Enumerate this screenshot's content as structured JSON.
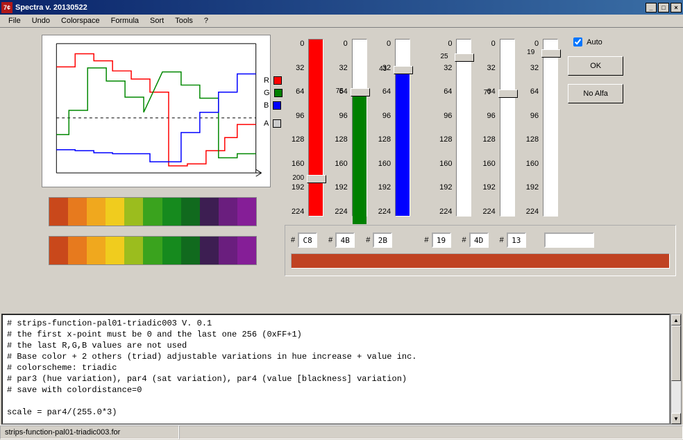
{
  "window": {
    "title": "Spectra v. 20130522"
  },
  "menu": {
    "file": "File",
    "undo": "Undo",
    "colorspace": "Colorspace",
    "formula": "Formula",
    "sort": "Sort",
    "tools": "Tools",
    "help": "?"
  },
  "legend": {
    "r": "R",
    "g": "G",
    "b": "B",
    "a": "A"
  },
  "ticks": [
    "0",
    "32",
    "64",
    "96",
    "128",
    "160",
    "192",
    "224"
  ],
  "sliders": {
    "r": {
      "value": 200,
      "hex": "C8"
    },
    "g": {
      "value": 75,
      "hex": "4B"
    },
    "b": {
      "value": 43,
      "hex": "2B"
    },
    "s4": {
      "value": 25,
      "hex": "19"
    },
    "s5": {
      "value": 77,
      "hex": "4D"
    },
    "s6": {
      "value": 19,
      "hex": "13"
    }
  },
  "buttons": {
    "auto_label": "Auto",
    "auto_checked": true,
    "ok": "OK",
    "noalfa": "No Alfa"
  },
  "hex_prefix": "#",
  "palette": [
    "#c9481b",
    "#e77a1e",
    "#f0a81e",
    "#f0cc1e",
    "#9bbd1e",
    "#3aa31e",
    "#168a1e",
    "#116a1e",
    "#3d1e52",
    "#6a1e7e",
    "#851e97"
  ],
  "chart_data": {
    "type": "line",
    "xlim": [
      0,
      256
    ],
    "ylim": [
      0,
      256
    ],
    "series": [
      {
        "name": "R",
        "color": "#ff0000",
        "points": [
          [
            0,
            210
          ],
          [
            24,
            210
          ],
          [
            24,
            236
          ],
          [
            48,
            236
          ],
          [
            48,
            222
          ],
          [
            72,
            222
          ],
          [
            72,
            202
          ],
          [
            96,
            202
          ],
          [
            96,
            186
          ],
          [
            120,
            186
          ],
          [
            120,
            160
          ],
          [
            144,
            160
          ],
          [
            144,
            14
          ],
          [
            168,
            14
          ],
          [
            168,
            18
          ],
          [
            192,
            18
          ],
          [
            192,
            44
          ],
          [
            216,
            44
          ],
          [
            216,
            70
          ],
          [
            232,
            70
          ],
          [
            232,
            96
          ],
          [
            256,
            96
          ]
        ]
      },
      {
        "name": "G",
        "color": "#008800",
        "points": [
          [
            0,
            76
          ],
          [
            16,
            76
          ],
          [
            16,
            124
          ],
          [
            40,
            124
          ],
          [
            40,
            208
          ],
          [
            64,
            208
          ],
          [
            64,
            182
          ],
          [
            88,
            182
          ],
          [
            88,
            150
          ],
          [
            112,
            150
          ],
          [
            112,
            120
          ],
          [
            136,
            200
          ],
          [
            160,
            200
          ],
          [
            160,
            174
          ],
          [
            184,
            174
          ],
          [
            184,
            148
          ],
          [
            208,
            148
          ],
          [
            208,
            30
          ],
          [
            232,
            30
          ],
          [
            232,
            38
          ],
          [
            256,
            38
          ]
        ]
      },
      {
        "name": "B",
        "color": "#0000ff",
        "points": [
          [
            0,
            46
          ],
          [
            24,
            46
          ],
          [
            24,
            44
          ],
          [
            48,
            44
          ],
          [
            48,
            40
          ],
          [
            72,
            40
          ],
          [
            72,
            38
          ],
          [
            120,
            38
          ],
          [
            120,
            22
          ],
          [
            160,
            22
          ],
          [
            160,
            80
          ],
          [
            184,
            80
          ],
          [
            184,
            120
          ],
          [
            208,
            120
          ],
          [
            208,
            160
          ],
          [
            232,
            160
          ],
          [
            232,
            196
          ],
          [
            256,
            196
          ]
        ]
      }
    ]
  },
  "script_text": "# strips-function-pal01-triadic003 V. 0.1\n# the first x-point must be 0 and the last one 256 (0xFF+1)\n# the last R,G,B values are not used\n# Base color + 2 others (triad) adjustable variations in hue increase + value inc.\n# colorscheme: triadic\n# par3 (hue variation), par4 (sat variation), par4 (value [blackness] variation)\n# save with colordistance=0\n\nscale = par4/(255.0*3)",
  "status": {
    "file": "strips-function-pal01-triadic003.for"
  }
}
